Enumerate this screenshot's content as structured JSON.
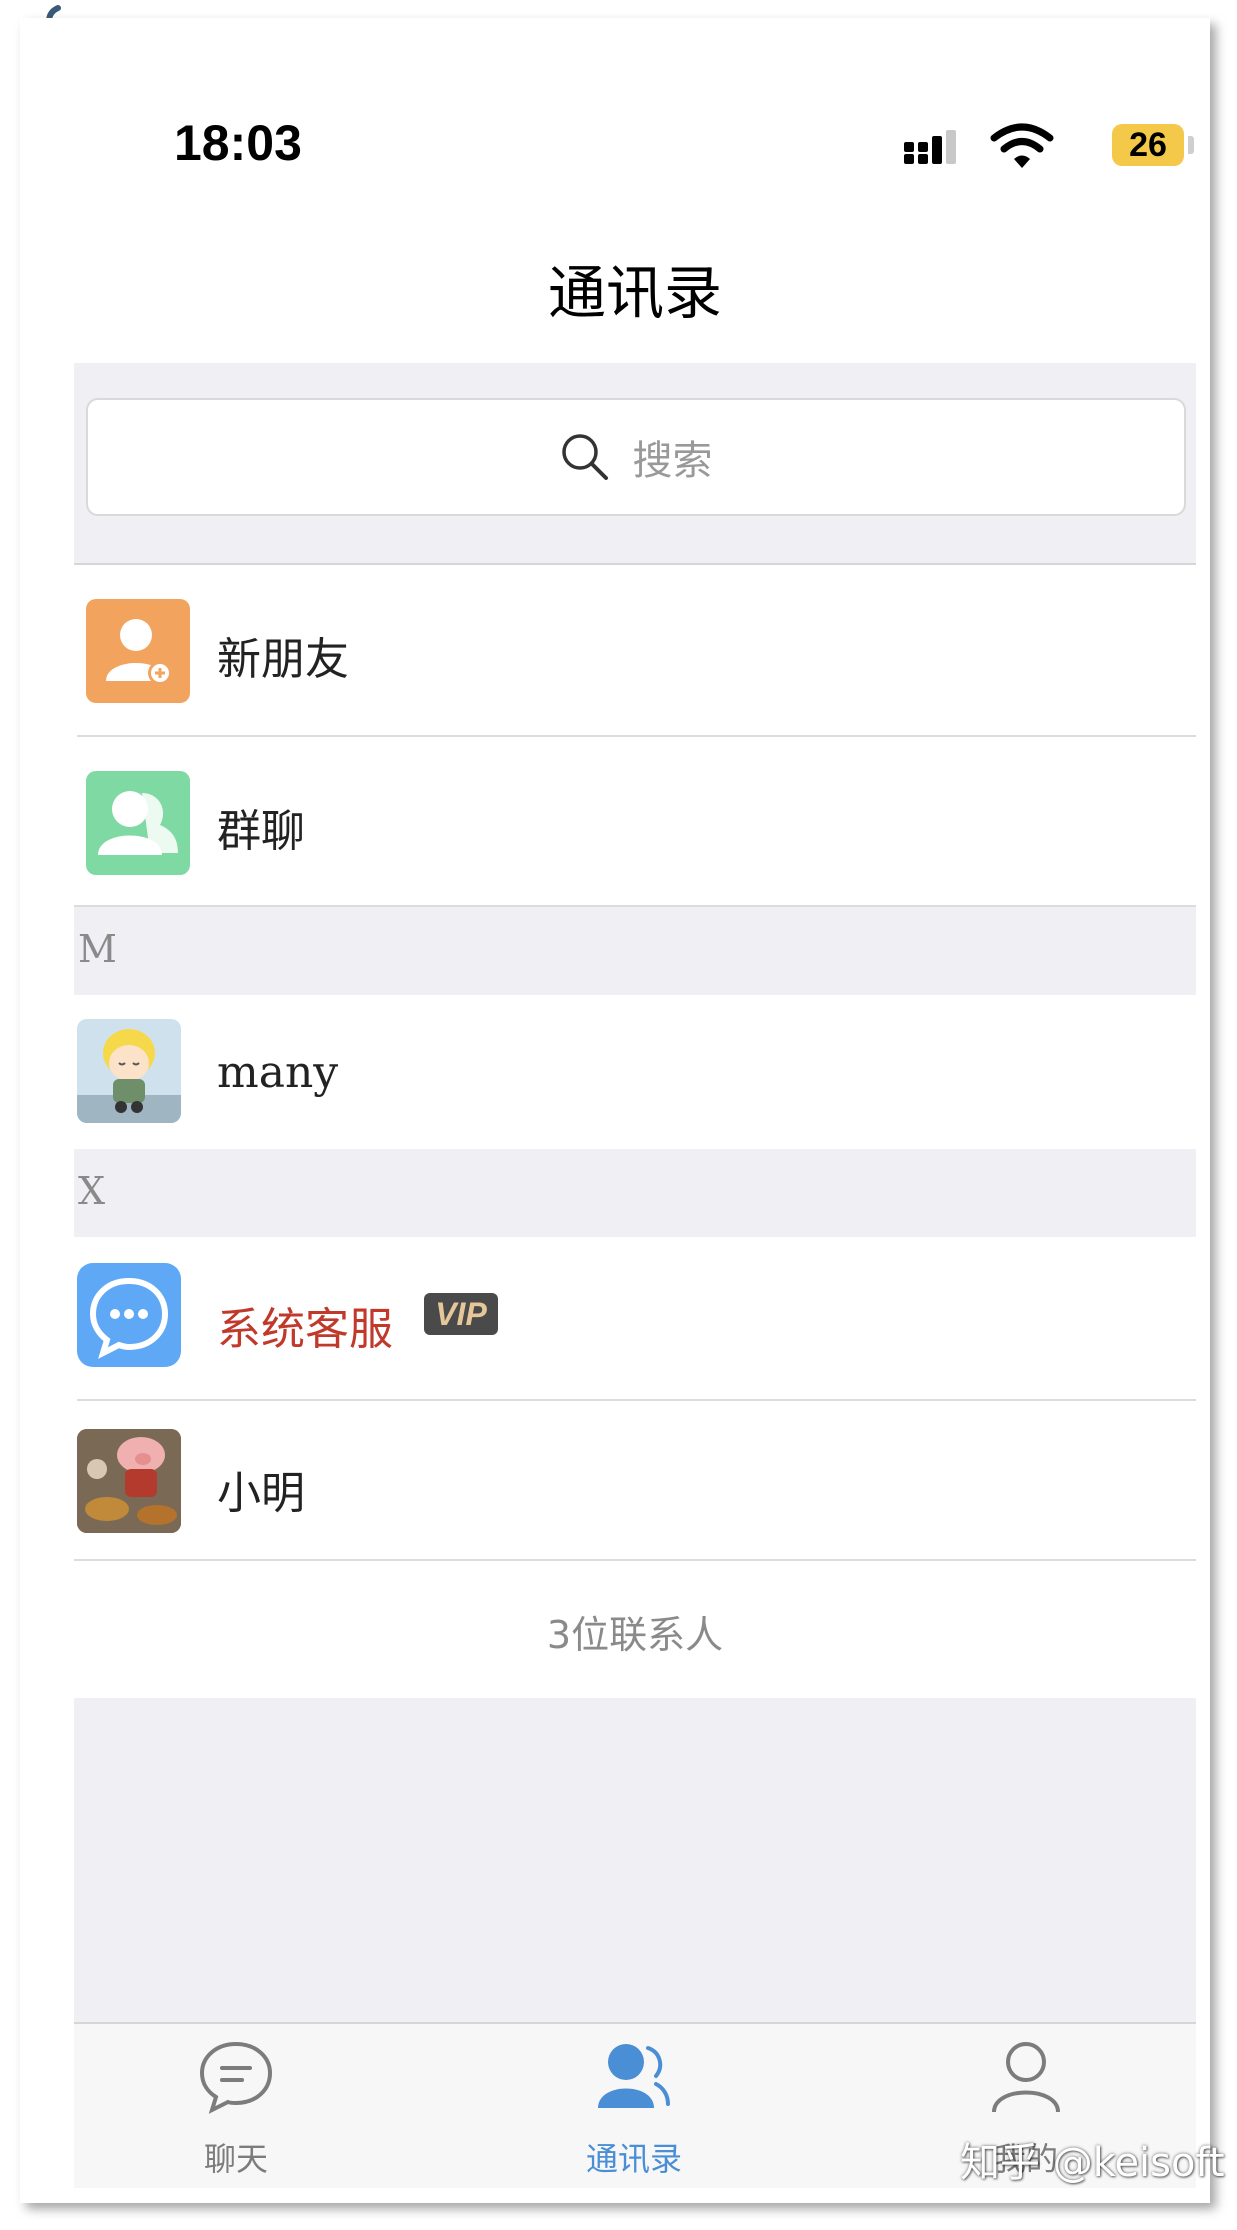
{
  "status_bar": {
    "time": "18:03",
    "battery": "26"
  },
  "header": {
    "title": "通讯录"
  },
  "search": {
    "placeholder": "搜索"
  },
  "entries": [
    {
      "label": "新朋友",
      "icon": "add-friend-icon",
      "color": "#f2a35e"
    },
    {
      "label": "群聊",
      "icon": "group-chat-icon",
      "color": "#7ed9a3"
    }
  ],
  "sections": [
    {
      "letter": "M",
      "contacts": [
        {
          "name": "many",
          "avatar": "cartoon-boy-avatar"
        }
      ]
    },
    {
      "letter": "X",
      "contacts": [
        {
          "name": "系统客服",
          "avatar": "chat-bubble-icon",
          "badge": "VIP",
          "name_color": "#c0392b"
        },
        {
          "name": "小明",
          "avatar": "pig-figure-avatar"
        }
      ]
    }
  ],
  "contact_count": "3位联系人",
  "tabs": [
    {
      "label": "聊天",
      "icon": "chat-icon",
      "active": false
    },
    {
      "label": "通讯录",
      "icon": "contacts-icon",
      "active": true
    },
    {
      "label": "我的",
      "icon": "profile-icon",
      "active": false
    }
  ],
  "colors": {
    "accent": "#4a8ed6",
    "vip_badge_bg": "#4a4a4a",
    "service_avatar": "#5ea8f5"
  },
  "watermark": "知乎 @keisoft"
}
